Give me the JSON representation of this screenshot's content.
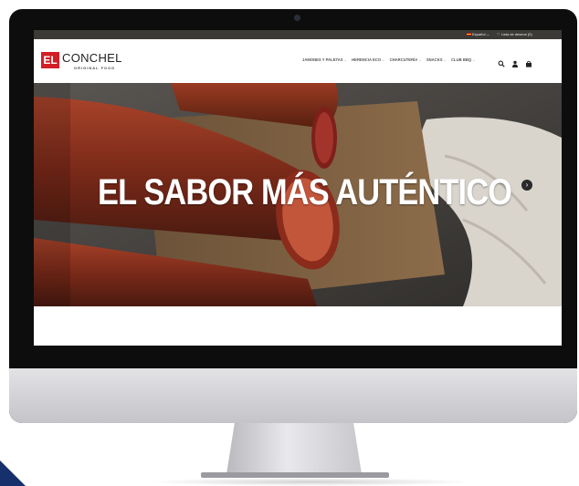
{
  "topbar": {
    "language": "Español",
    "wishlist": "♡ Lista de deseos (0)"
  },
  "brand": {
    "badge": "EL",
    "name": "CONCHEL",
    "tagline": "ORIGINAL FOOD",
    "accent_color": "#d21f26"
  },
  "nav": {
    "items": [
      {
        "label": "JAMONES Y PALETAS"
      },
      {
        "label": "HERENCIA ECO"
      },
      {
        "label": "CHARCUTERÍA"
      },
      {
        "label": "SNACKS"
      },
      {
        "label": "CLUB BBQ"
      }
    ],
    "icons": [
      "search-icon",
      "user-icon",
      "cart-icon"
    ]
  },
  "hero": {
    "headline": "EL SABOR MÁS AUTÉNTICO",
    "next_icon": "chevron-right-icon"
  }
}
